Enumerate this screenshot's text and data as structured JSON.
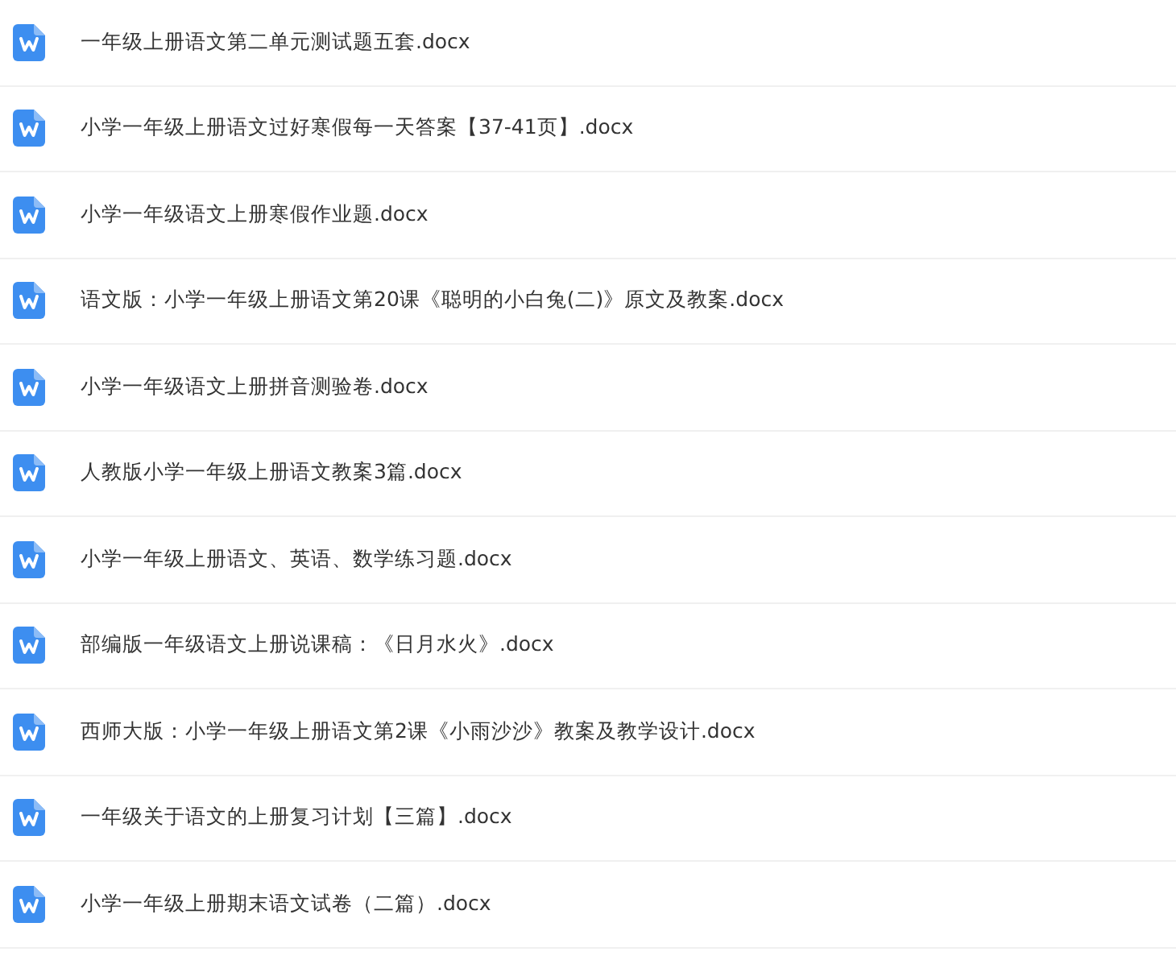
{
  "files": [
    {
      "name": "一年级上册语文第二单元测试题五套.docx"
    },
    {
      "name": "小学一年级上册语文过好寒假每一天答案【37-41页】.docx"
    },
    {
      "name": "小学一年级语文上册寒假作业题.docx"
    },
    {
      "name": "语文版：小学一年级上册语文第20课《聪明的小白兔(二)》原文及教案.docx"
    },
    {
      "name": "小学一年级语文上册拼音测验卷.docx"
    },
    {
      "name": "人教版小学一年级上册语文教案3篇.docx"
    },
    {
      "name": "小学一年级上册语文、英语、数学练习题.docx"
    },
    {
      "name": "部编版一年级语文上册说课稿：《日月水火》.docx"
    },
    {
      "name": "西师大版：小学一年级上册语文第2课《小雨沙沙》教案及教学设计.docx"
    },
    {
      "name": "一年级关于语文的上册复习计划【三篇】.docx"
    },
    {
      "name": "小学一年级上册期末语文试卷（二篇）.docx"
    }
  ]
}
